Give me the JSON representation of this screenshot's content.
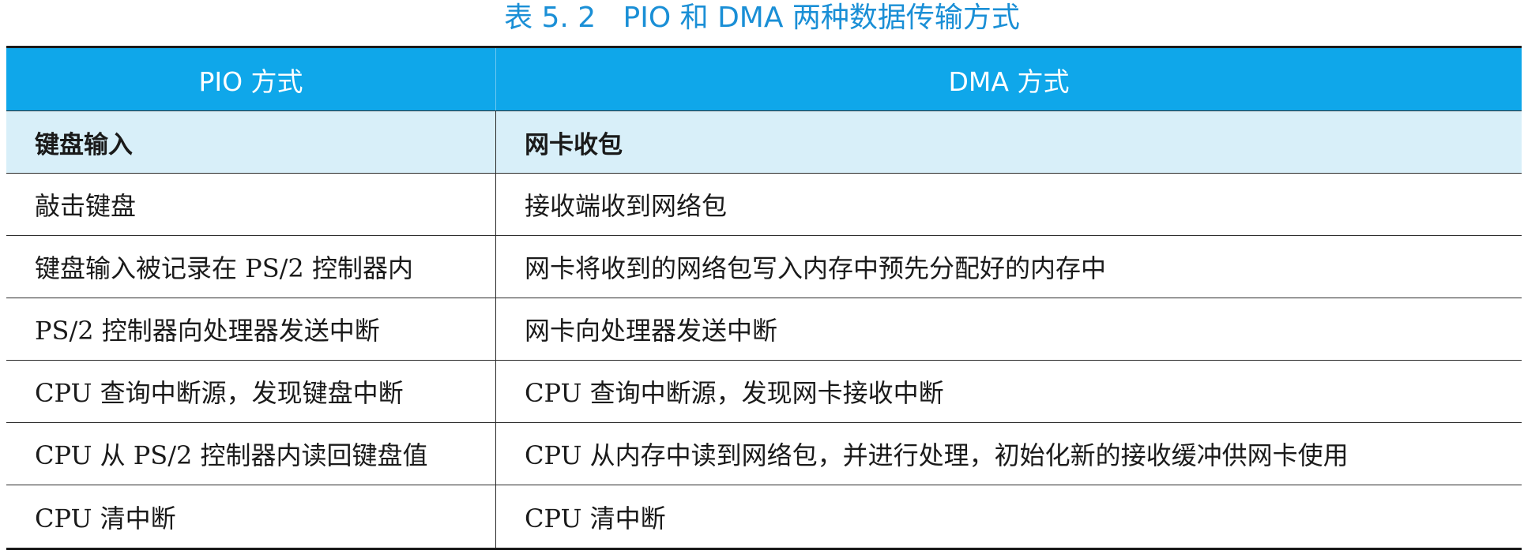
{
  "caption": "表 5. 2   PIO 和 DMA 两种数据传输方式",
  "header": {
    "col_pio": "PIO 方式",
    "col_dma": "DMA 方式"
  },
  "subheader": {
    "pio": "键盘输入",
    "dma": "网卡收包"
  },
  "rows": [
    {
      "pio": "敲击键盘",
      "dma": "接收端收到网络包"
    },
    {
      "pio": "键盘输入被记录在 PS/2 控制器内",
      "dma": "网卡将收到的网络包写入内存中预先分配好的内存中"
    },
    {
      "pio": "PS/2 控制器向处理器发送中断",
      "dma": "网卡向处理器发送中断"
    },
    {
      "pio": "CPU 查询中断源，发现键盘中断",
      "dma": "CPU 查询中断源，发现网卡接收中断"
    },
    {
      "pio": "CPU 从 PS/2 控制器内读回键盘值",
      "dma": "CPU 从内存中读到网络包，并进行处理，初始化新的接收缓冲供网卡使用"
    },
    {
      "pio": "CPU 清中断",
      "dma": "CPU 清中断"
    }
  ],
  "colors": {
    "caption": "#1a8fd6",
    "header_bg": "#0fa7ea",
    "subheader_bg": "#d8eff9"
  }
}
